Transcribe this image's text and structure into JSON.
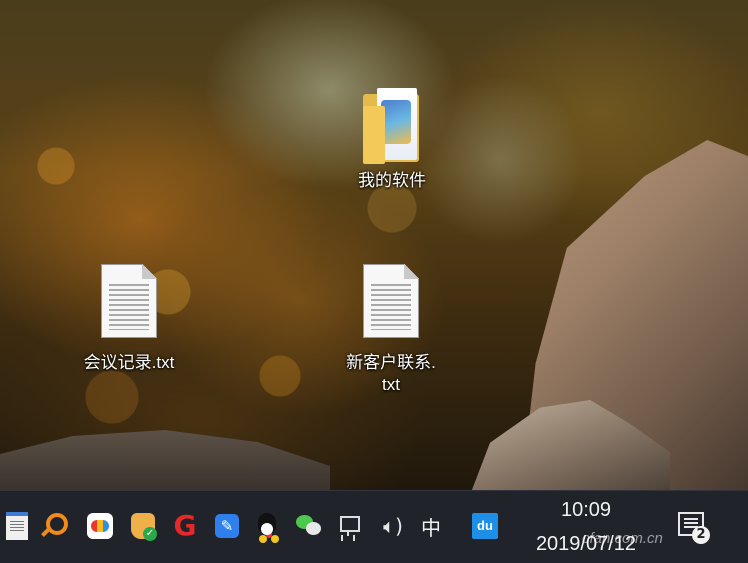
{
  "desktop": {
    "icons": [
      {
        "label": "我的软件",
        "icon": "folder-icon"
      },
      {
        "label": "会议记录.txt",
        "icon": "text-file-icon"
      },
      {
        "label_line1": "新客户联系.",
        "label_line2": "txt",
        "icon": "text-file-icon"
      }
    ]
  },
  "taskbar": {
    "pinned": [
      {
        "name": "notepad-icon"
      },
      {
        "name": "search-icon"
      },
      {
        "name": "baidu-netdisk-icon"
      },
      {
        "name": "security-guard-icon"
      },
      {
        "name": "g-app-icon"
      },
      {
        "name": "memo-icon"
      },
      {
        "name": "qq-icon"
      }
    ],
    "tray": [
      {
        "name": "wechat-icon"
      },
      {
        "name": "network-icon"
      },
      {
        "name": "speaker-icon"
      }
    ],
    "ime_label": "中",
    "du_label": "du",
    "clock": {
      "time": "10:09",
      "date": "2019/07/12"
    },
    "notification_badge": "2"
  },
  "watermark": "cfan.com.cn",
  "colors": {
    "taskbar": "#20232a",
    "du_accent": "#1d8fe6",
    "folder": "#e6b94c"
  }
}
